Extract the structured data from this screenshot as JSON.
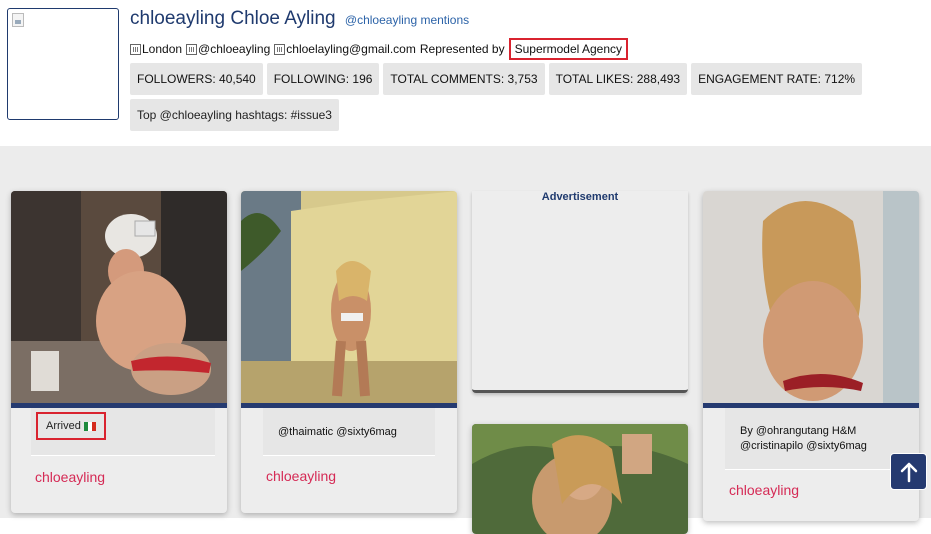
{
  "profile": {
    "display_name": "chloeayling Chloe Ayling",
    "mentions_link": "@chloeayling mentions",
    "location": "London",
    "handle": "@chloeayling",
    "email": "chloelayling@gmail.com",
    "represented_by_label": "Represented by",
    "agency": "Supermodel Agency"
  },
  "stats": [
    "FOLLOWERS: 40,540",
    "FOLLOWING: 196",
    "TOTAL COMMENTS: 3,753",
    "TOTAL LIKES: 288,493",
    "ENGAGEMENT RATE: 712%"
  ],
  "hashtags": "Top @chloeayling hashtags: #issue3",
  "ad_label": "Advertisement",
  "posts": [
    {
      "caption": "Arrived",
      "flag": "italy-flag-icon",
      "username": "chloeayling"
    },
    {
      "caption": "@thaimatic @sixty6mag",
      "username": "chloeayling"
    },
    {
      "caption": "By @ohrangutang H&M @cristinapilo @sixty6mag",
      "username": "chloeayling"
    }
  ],
  "icons": {
    "scroll_top": "arrow-up-icon",
    "broken_image": "broken-image-icon",
    "inline_glyph": "missing-glyph-icon"
  },
  "colors": {
    "brand_navy": "#253a70",
    "link_blue": "#2c63a8",
    "username_pink": "#d52a55",
    "highlight_red": "#d9232f"
  }
}
